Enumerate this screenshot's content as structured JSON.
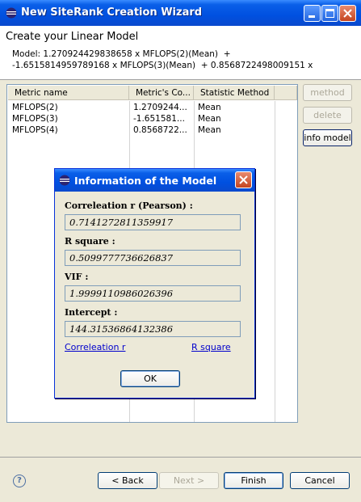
{
  "window": {
    "title": "New SiteRank Creation Wizard",
    "accent": "#0A5FE8"
  },
  "header": {
    "heading": "Create your Linear Model",
    "model_line1": "Model: 1.270924429838658 x MFLOPS(2)(Mean)  +",
    "model_line2": "-1.6515814959789168 x MFLOPS(3)(Mean)  + 0.8568722498009151 x"
  },
  "table": {
    "columns": [
      "Metric name",
      "Metric's Co...",
      "Statistic Method"
    ],
    "rows": [
      [
        "MFLOPS(2)",
        "1.2709244...",
        "Mean"
      ],
      [
        "MFLOPS(3)",
        "-1.651581...",
        "Mean"
      ],
      [
        "MFLOPS(4)",
        "0.8568722...",
        "Mean"
      ]
    ]
  },
  "side_buttons": {
    "method": "method",
    "delete": "delete",
    "info_model": "info model"
  },
  "dialog": {
    "title": "Information of the Model",
    "correlation_label": "Correleation r (Pearson) :",
    "correlation_value": "0.7141272811359917",
    "rsquare_label": "R square :",
    "rsquare_value": "0.5099777736626837",
    "vif_label": "VIF :",
    "vif_value": "1.9999110986026396",
    "intercept_label": "Intercept :",
    "intercept_value": "144.31536864132386",
    "link_correlation": "Correleation r",
    "link_rsquare": "R square",
    "ok": "OK"
  },
  "footer": {
    "help_glyph": "?",
    "back": "< Back",
    "next": "Next >",
    "finish": "Finish",
    "cancel": "Cancel"
  }
}
